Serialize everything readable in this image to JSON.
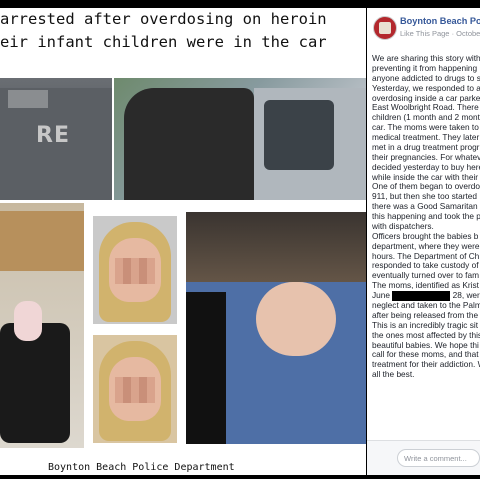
{
  "headline": {
    "line1": "arrested after overdosing on heroin",
    "line2": "eir infant children were in the car"
  },
  "photo_badge_text": "RE",
  "caption": "Boynton Beach Police Department",
  "post": {
    "page_name": "Boynton Beach Poli",
    "like_label": "Like This Page",
    "separator": "·",
    "date": "October",
    "lines": [
      "We are sharing this story with",
      "preventing it from happening",
      "anyone addicted to drugs to s",
      "Yesterday, we responded to a",
      "overdosing inside a car parke",
      "East Woolbright Road. There",
      "children (1 month and 2 mont",
      "car. The moms were taken to",
      "medical treatment. They later",
      "met in a drug treatment progr",
      "their pregnancies. For whatev",
      "decided yesterday to buy here",
      "while inside the car with their",
      "One of them began to overdo",
      "911, but then she too started",
      "there was a Good Samaritan",
      "this happening and took the p",
      "with dispatchers.",
      "Officers brought the babies b",
      "department, where they were",
      "hours. The Department of Ch",
      "responded to take custody of",
      "eventually turned over to fam",
      "The moms, identified as Krist"
    ],
    "redacted_line_start": "June",
    "redacted_line_end": "28, were c",
    "lines_after": [
      "neglect and taken to the Palm",
      "after being released from the",
      "This is an incredibly tragic sit",
      "the ones most affected by this",
      "beautiful babies. We hope thi",
      "call for these moms, and that",
      "treatment for their addiction. W",
      "all the best."
    ],
    "comment_placeholder": "Write a comment..."
  }
}
